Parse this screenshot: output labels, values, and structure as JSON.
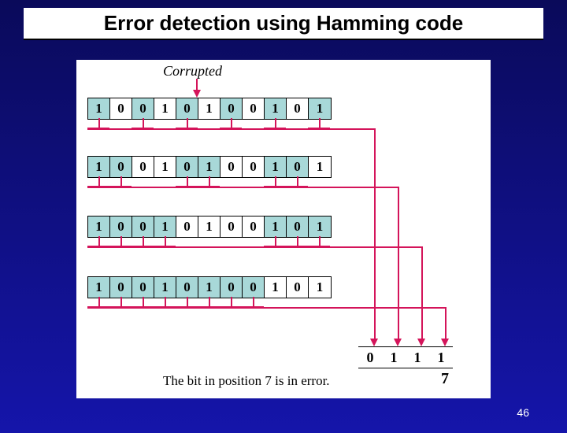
{
  "title": "Error detection using Hamming code",
  "corrupted_label": "Corrupted",
  "rows": {
    "r1": [
      "1",
      "0",
      "0",
      "1",
      "0",
      "1",
      "0",
      "0",
      "1",
      "0",
      "1"
    ],
    "r2": [
      "1",
      "0",
      "0",
      "1",
      "0",
      "1",
      "0",
      "0",
      "1",
      "0",
      "1"
    ],
    "r3": [
      "1",
      "0",
      "0",
      "1",
      "0",
      "1",
      "0",
      "0",
      "1",
      "0",
      "1"
    ],
    "r4": [
      "1",
      "0",
      "0",
      "1",
      "0",
      "1",
      "0",
      "0",
      "1",
      "0",
      "1"
    ]
  },
  "highlight": {
    "r1": [
      0,
      2,
      4,
      6,
      8,
      10
    ],
    "r2": [
      0,
      1,
      4,
      5,
      8,
      9
    ],
    "r3": [
      0,
      1,
      2,
      3,
      8,
      9,
      10
    ],
    "r4": [
      0,
      1,
      2,
      3,
      4,
      5,
      6,
      7
    ]
  },
  "drops": {
    "r1": [
      0,
      2,
      4,
      6,
      8,
      10
    ],
    "r2": [
      0,
      1,
      4,
      5,
      8,
      9
    ],
    "r3": [
      0,
      1,
      2,
      3,
      8,
      9,
      10
    ],
    "r4": [
      0,
      1,
      2,
      3,
      4,
      5,
      6,
      7
    ]
  },
  "syndrome": [
    "0",
    "1",
    "1",
    "1"
  ],
  "result_position": "7",
  "caption": "The bit in position 7 is in error.",
  "page": "46"
}
